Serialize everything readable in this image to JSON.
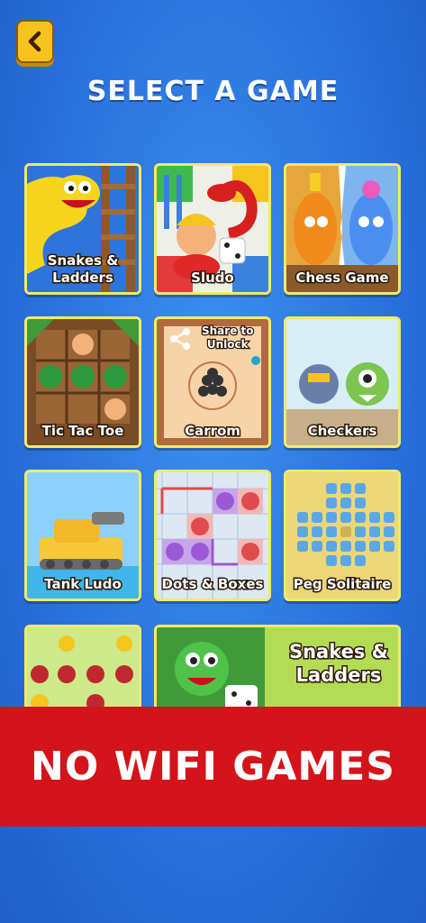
{
  "header": {
    "title": "SELECT A GAME",
    "back_icon": "chevron-left-icon"
  },
  "games": [
    {
      "label": "Snakes &\nLadders"
    },
    {
      "label": "Sludo"
    },
    {
      "label": "Chess Game"
    },
    {
      "label": "Tic Tac Toe"
    },
    {
      "label": "Carrom",
      "share_label": "Share to\nUnlock"
    },
    {
      "label": "Checkers"
    },
    {
      "label": "Tank Ludo"
    },
    {
      "label": "Dots & Boxes"
    },
    {
      "label": "Peg Solitaire"
    },
    {
      "label": ""
    },
    {
      "label": "Snakes &\nLadders"
    }
  ],
  "banner": {
    "text": "NO WIFI GAMES"
  },
  "colors": {
    "banner": "#d4141b",
    "tile_border": "#f3e968",
    "back_button": "#f7c21e"
  }
}
